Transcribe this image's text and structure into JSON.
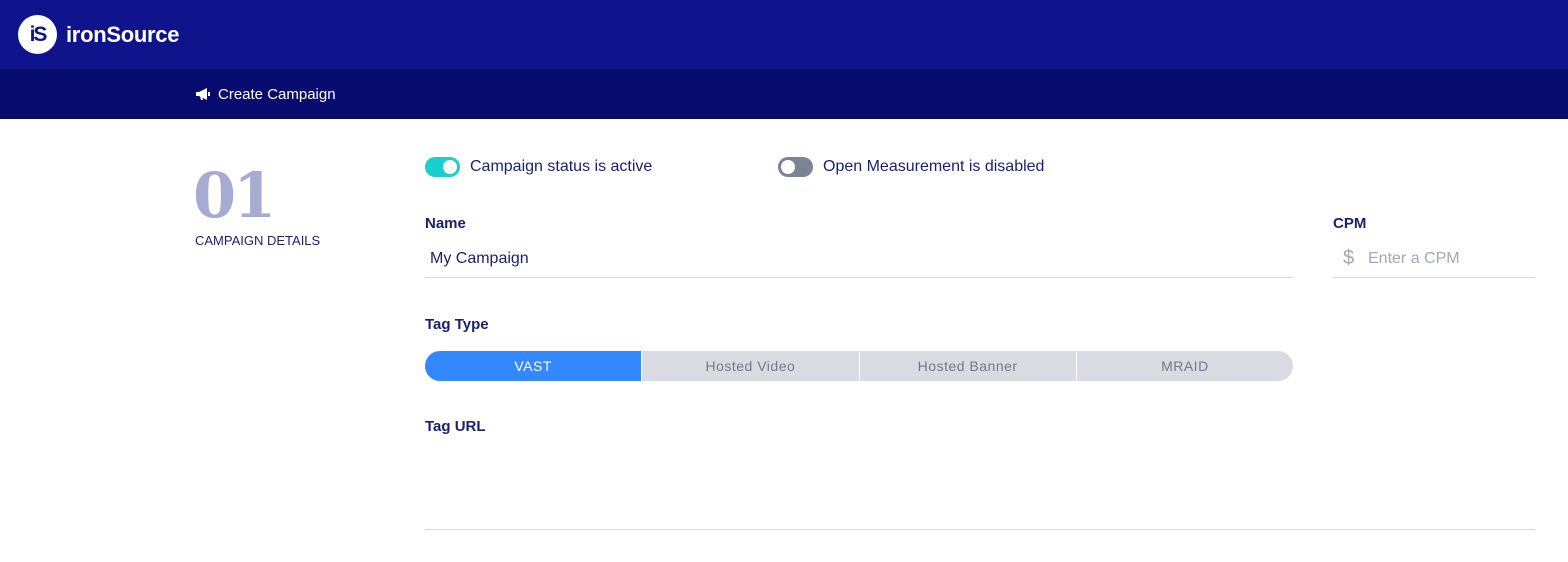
{
  "app": {
    "logo_mark": "iS",
    "brand_name": "ironSource"
  },
  "subheader": {
    "icon": "megaphone-icon",
    "title": "Create Campaign"
  },
  "step": {
    "number": "01",
    "label": "CAMPAIGN DETAILS"
  },
  "toggles": {
    "status": {
      "label": "Campaign status is active",
      "on": true
    },
    "measurement": {
      "label": "Open Measurement is disabled",
      "on": false
    }
  },
  "name_field": {
    "label": "Name",
    "value": "My Campaign"
  },
  "cpm_field": {
    "label": "CPM",
    "currency_symbol": "$",
    "placeholder": "Enter a CPM",
    "value": ""
  },
  "tag_type": {
    "label": "Tag Type",
    "options": [
      "VAST",
      "Hosted Video",
      "Hosted Banner",
      "MRAID"
    ],
    "selected": "VAST"
  },
  "tag_url": {
    "label": "Tag URL",
    "value": ""
  },
  "colors": {
    "header_bg": "#10148c",
    "subheader_bg": "#080c6e",
    "toggle_on": "#1ccfcf",
    "toggle_off": "#7b8494",
    "segment_active": "#3488ff",
    "text_primary": "#1a1f71"
  }
}
